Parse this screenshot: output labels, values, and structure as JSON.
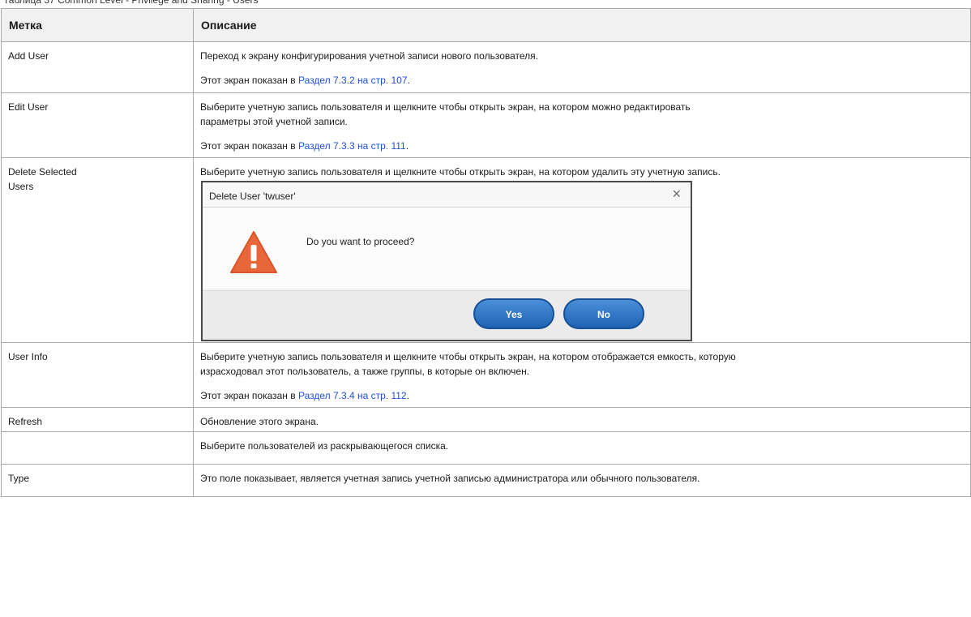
{
  "caption": "Таблица 37  Common Level - Privilege and Sharing - Users",
  "table": {
    "headers": [
      "Метка",
      "Описание"
    ],
    "rows": [
      {
        "label": "Add User",
        "desc1": "Переход к экрану конфигурирования учетной записи нового пользователя.",
        "ref_prefix": "Этот экран показан в ",
        "ref_link": "Раздел 7.3.2 на стр. 107",
        "ref_suffix": "."
      },
      {
        "label": "Edit User",
        "desc1": "Выберите учетную запись пользователя и щелкните чтобы открыть экран, на котором можно редактировать",
        "desc2": "параметры этой учетной записи.",
        "ref_prefix": "Этот экран показан в ",
        "ref_link": "Раздел 7.3.3 на стр. 111",
        "ref_suffix": "."
      },
      {
        "label1": "Delete Selected",
        "label2": "Users",
        "desc1": "Выберите учетную запись пользователя и щелкните чтобы открыть экран, на котором удалить эту учетную запись."
      },
      {
        "label": "User Info",
        "desc1": "Выберите учетную запись пользователя и щелкните чтобы открыть экран, на котором отображается емкость, которую",
        "desc2": "израсходовал этот пользователь, а также группы, в которые он включен.",
        "ref_prefix": "Этот экран показан в ",
        "ref_link": "Раздел 7.3.4 на стр. 112",
        "ref_suffix": "."
      },
      {
        "label": "Refresh",
        "desc1": "Обновление этого экрана."
      },
      {
        "label": "",
        "desc1": "Выберите пользователей из раскрывающегося списка."
      },
      {
        "label": "Type",
        "desc1": "Это поле показывает, является учетная запись учетной записью администратора или обычного пользователя."
      }
    ]
  },
  "dialog": {
    "title": "Delete User 'twuser'",
    "message": "Do you want to proceed?",
    "yes_label": "Yes",
    "no_label": "No",
    "close_glyph": "×",
    "warning_color": "#e8673a",
    "button_color": "#2a6fc2"
  }
}
